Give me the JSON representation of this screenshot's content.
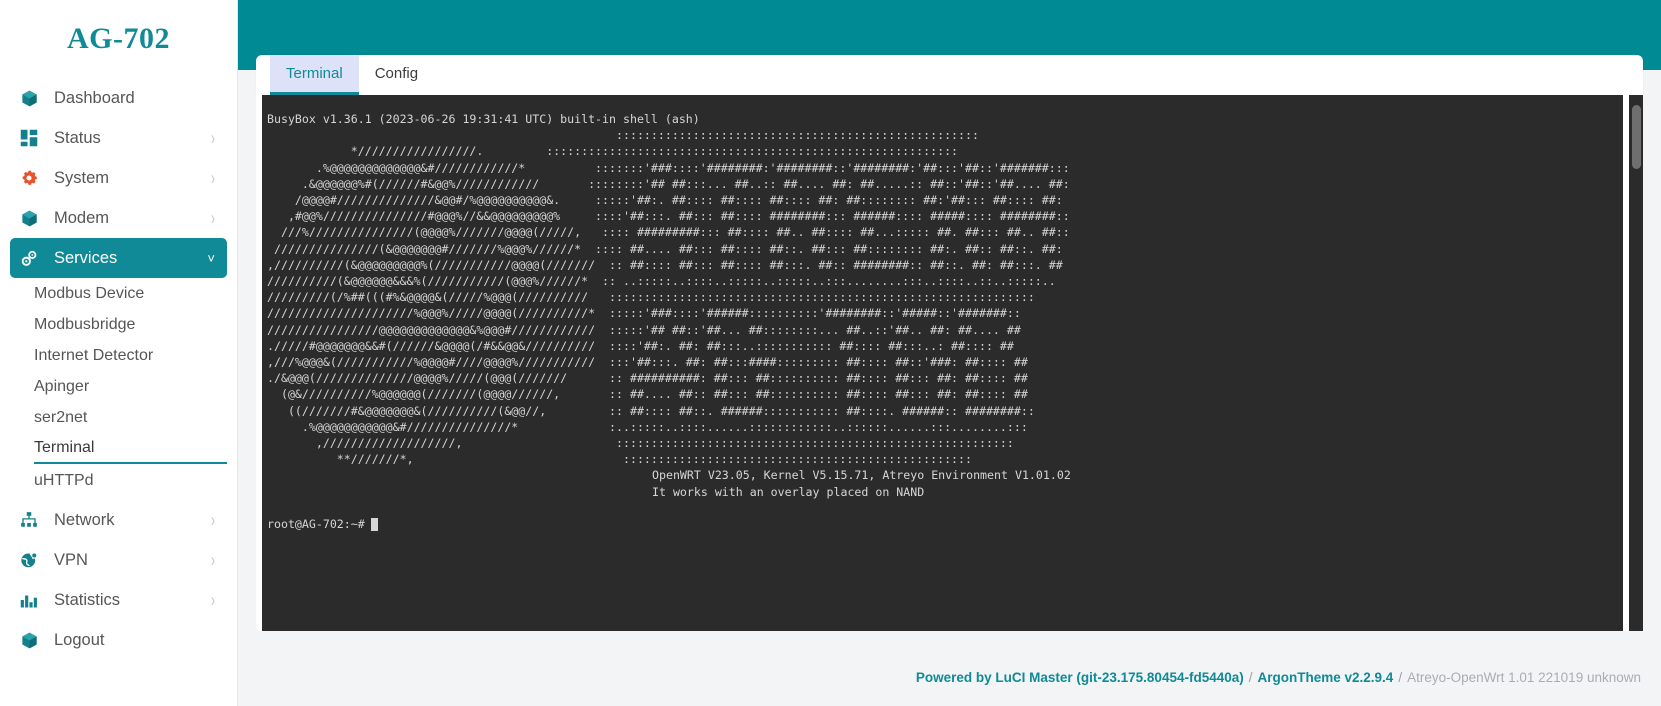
{
  "brand": {
    "title": "AG-702"
  },
  "sidebar": {
    "items": [
      {
        "label": "Dashboard",
        "icon": "cube-icon",
        "expandable": false,
        "active": false
      },
      {
        "label": "Status",
        "icon": "grid-icon",
        "expandable": true,
        "active": false
      },
      {
        "label": "System",
        "icon": "gear-icon",
        "expandable": true,
        "active": false
      },
      {
        "label": "Modem",
        "icon": "cube-icon",
        "expandable": true,
        "active": false
      },
      {
        "label": "Services",
        "icon": "gears-icon",
        "expandable": true,
        "active": true
      }
    ],
    "sub_items": [
      {
        "label": "Modbus Device",
        "current": false
      },
      {
        "label": "Modbusbridge",
        "current": false
      },
      {
        "label": "Internet Detector",
        "current": false
      },
      {
        "label": "Apinger",
        "current": false
      },
      {
        "label": "ser2net",
        "current": false
      },
      {
        "label": "Terminal",
        "current": true
      },
      {
        "label": "uHTTPd",
        "current": false
      }
    ],
    "items_bottom": [
      {
        "label": "Network",
        "icon": "sitemap-icon",
        "expandable": true,
        "active": false
      },
      {
        "label": "VPN",
        "icon": "globe-icon",
        "expandable": true,
        "active": false
      },
      {
        "label": "Statistics",
        "icon": "barchart-icon",
        "expandable": true,
        "active": false
      },
      {
        "label": "Logout",
        "icon": "cube-icon",
        "expandable": false,
        "active": false
      }
    ]
  },
  "tabs": [
    {
      "label": "Terminal",
      "active": true
    },
    {
      "label": "Config",
      "active": false
    }
  ],
  "terminal": {
    "banner_line": "BusyBox v1.36.1 (2023-06-26 19:31:41 UTC) built-in shell (ash)",
    "prompt": "root@AG-702:~#",
    "info_line_1": "OpenWRT V23.05, Kernel V5.15.71, Atreyo Environment V1.01.02",
    "info_line_2": "It works with an overlay placed on NAND",
    "ascii_art": "                                                  ::::::::::::::::::::::::::::::::::::::::::::::::::::\n            */////////////////.         :::::::::::::::::::::::::::::::::::::::::::::::::::::::::::\n       .%@@@@@@@@@@@@@&#////////////*          :::::::'###::::'########:'########::'########:'##:::'##::'#######:::\n     .&@@@@@@%#(//////#&@@%////////////       ::::::::'## ##:::... ##..:: ##.... ##: ##.....:: ##::'##::'##.... ##:\n    /@@@@#//////////////&@@#/%@@@@@@@@@@&.     :::::'##:. ##:::: ##:::: ##:::: ##: ##:::::::: ##:'##::: ##:::: ##:\n   ,#@@%///////////////#@@@%//&&@@@@@@@@@%     ::::'##:::. ##::: ##:::: ########::: ######:::: #####:::: ########::\n  ///%///////////////(@@@@%///////@@@@(/////,   :::: #########::: ##:::: ##.. ##:::: ##...::::: ##. ##::: ##.. ##::\n ///////////////(&@@@@@@@#///////%@@@%//////*  :::: ##.... ##::: ##:::: ##::. ##::: ##:::::::: ##:. ##:: ##::. ##:\n,//////////(&@@@@@@@@@%(///////////@@@@(///////  :: ##:::: ##::: ##:::: ##:::. ##:: ########:: ##::. ##: ##:::. ##\n//////////(&@@@@@@&&&%(///////////(@@@%//////*  :: ..:::::..::::..:::::..:::::..:::........:::..::::..::..:::::..\n/////////(/%##(((#%&@@@@&(/////%@@@(//////////   :::::::::::::::::::::::::::::::::::::::::::::::::::::::::::::\n/////////////////////%@@@%/////@@@@(//////////*  :::::'###::::'######::::::::::'########::'#####::'#######::\n////////////////@@@@@@@@@@@@@&%@@@#////////////  :::::'## ##::'##... ##::::::::... ##..::'##.. ##: ##.... ##\n./////#@@@@@@@&&#(//////&@@@@(/#&&@@&//////////  ::::'##:. ##: ##:::..::::::::::: ##:::: ##:::..: ##:::: ##\n,///%@@@&(///////////%@@@@#////@@@@%///////////  :::'##:::. ##: ##:::####::::::::: ##:::: ##::'###: ##:::: ##\n./&@@@(//////////////@@@@%/////(@@@(///////      :: ##########: ##::: ##:::::::::: ##:::: ##::: ##: ##:::: ##\n  (@&//////////%@@@@@@(///////(@@@@//////,       :: ##.... ##:: ##::: ##:::::::::: ##:::: ##::: ##: ##:::: ##\n   ((///////#&@@@@@@@&(//////////(&@@//,         :: ##:::: ##::. ######::::::::::: ##::::. ######:: ########::\n     .%@@@@@@@@@@@&#///////////////*             :..:::::..::::......::::::::::::..::::::......:::........:::\n       ,///////////////////,                      :::::::::::::::::::::::::::::::::::::::::::::::::::::::::\n          **///////*,                              ::::::::::::::::::::::::::::::::::::::::::::::::::"
  },
  "footer": {
    "luci_label": "Powered by LuCI Master (git-23.175.80454-fd5440a)",
    "separator": "/",
    "theme_label": "ArgonTheme v2.2.9.4",
    "tail_label": "Atreyo-OpenWrt 1.01 221019 unknown"
  },
  "colors": {
    "brand_teal": "#0f8a96",
    "header_teal": "#008b94",
    "active_tab_bg": "#dee2f8",
    "terminal_bg": "#2b2b2b",
    "terminal_fg": "#d6d6d6",
    "gear_orange": "#e8532c"
  }
}
